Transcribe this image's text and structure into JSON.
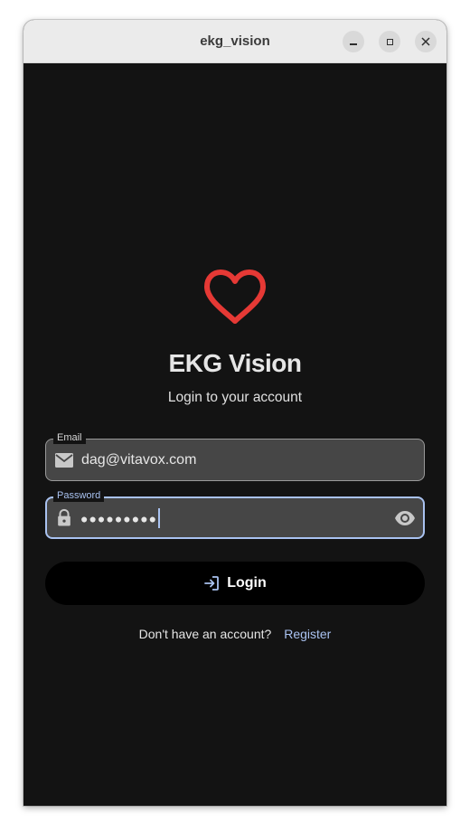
{
  "window": {
    "title": "ekg_vision"
  },
  "app": {
    "title": "EKG Vision",
    "subtitle": "Login to your account",
    "logo_icon": "heart-icon",
    "accent_color": "#e53935"
  },
  "form": {
    "email": {
      "label": "Email",
      "value": "dag@vitavox.com",
      "icon": "mail-icon"
    },
    "password": {
      "label": "Password",
      "masked_value": "●●●●●●●●●",
      "icon": "lock-icon",
      "toggle_icon": "eye-icon",
      "focus_color": "#a9c2f0"
    },
    "login_button": {
      "label": "Login",
      "icon": "login-icon"
    }
  },
  "footer": {
    "prompt": "Don't have an account?",
    "register_link": "Register"
  }
}
